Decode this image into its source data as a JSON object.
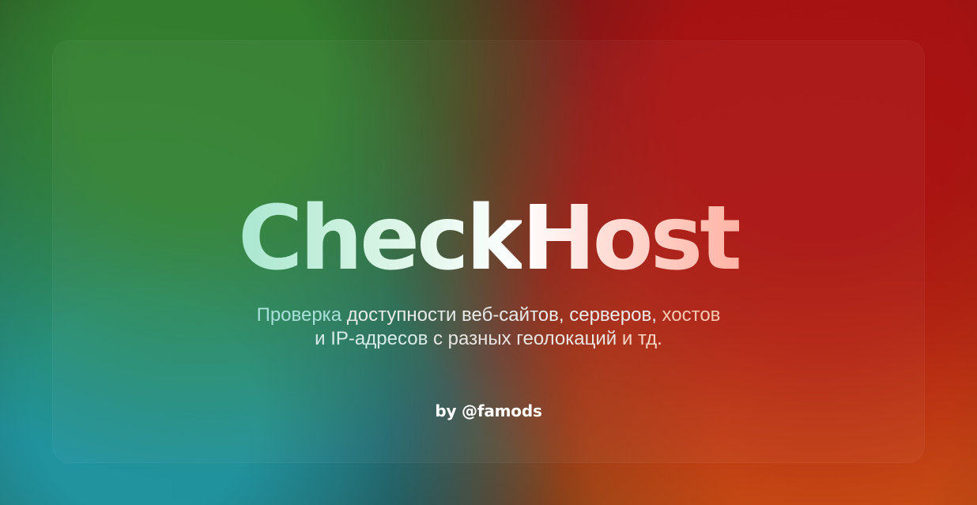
{
  "hero": {
    "title_part_1": "Check",
    "title_part_2": "Host",
    "subtitle_line_1_part_1": "Проверка ",
    "subtitle_line_1_part_2": "доступности веб-сайтов, серверов, ",
    "subtitle_line_1_part_3": "хостов",
    "subtitle_line_2_part_1": "и IP-адресов ",
    "subtitle_line_2_part_2": "с разных геолокаций ",
    "subtitle_line_2_part_3": "и тд.",
    "author": "by @famods"
  },
  "colors": {
    "green": "#2E7A2D",
    "red": "#A51313",
    "teal": "#2298A4",
    "orange": "#C75314",
    "title_left": "#A9E7D0",
    "title_right": "#FFB4A5"
  }
}
